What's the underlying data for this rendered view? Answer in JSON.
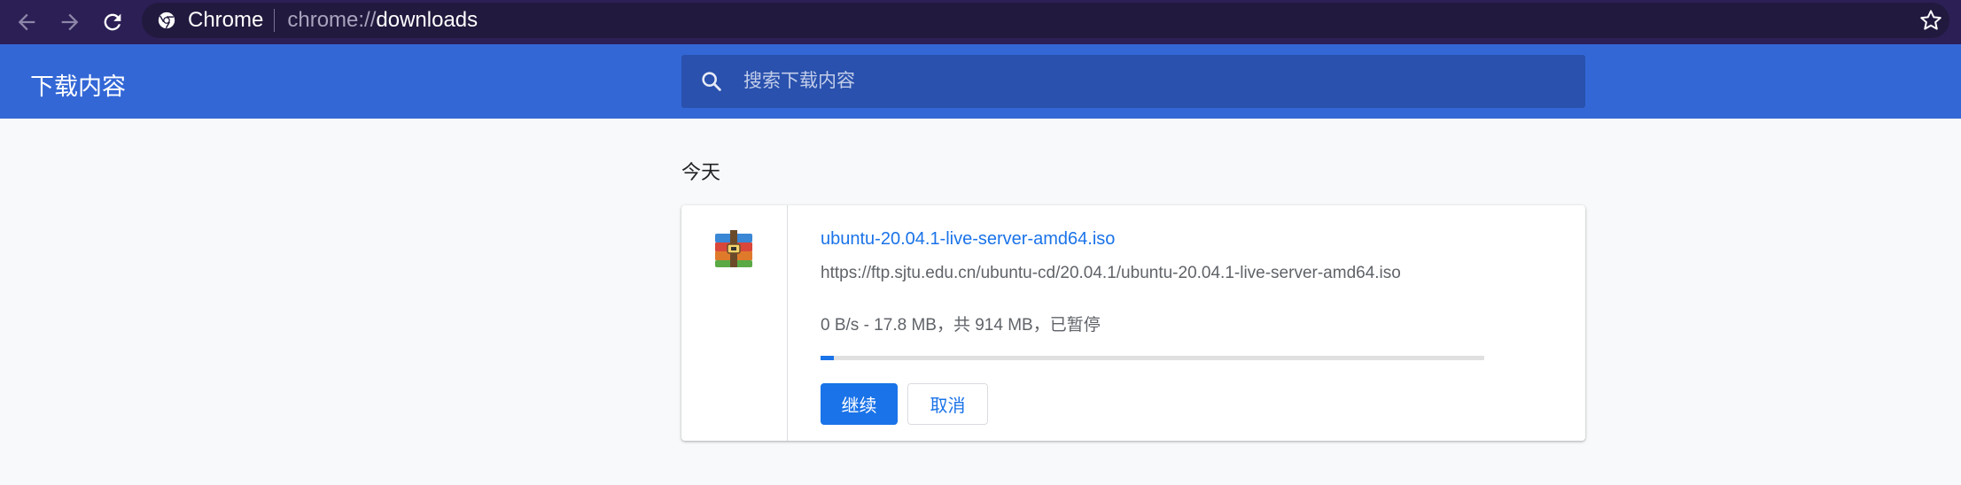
{
  "browser": {
    "site_name": "Chrome",
    "url_scheme": "chrome://",
    "url_host": "downloads",
    "icons": {
      "back": "back-arrow-icon",
      "forward": "forward-arrow-icon",
      "reload": "reload-icon",
      "site": "chrome-logo-icon",
      "bookmark": "star-icon"
    }
  },
  "header": {
    "title": "下载内容",
    "search_placeholder": "搜索下载内容",
    "search_value": ""
  },
  "section_date": "今天",
  "download": {
    "file_name": "ubuntu-20.04.1-live-server-amd64.iso",
    "url": "https://ftp.sjtu.edu.cn/ubuntu-cd/20.04.1/ubuntu-20.04.1-live-server-amd64.iso",
    "status": "0 B/s - 17.8 MB，共 914 MB，已暂停",
    "progress_fraction": 0.0195,
    "resume_label": "继续",
    "cancel_label": "取消",
    "icon": "winrar-archive-icon"
  },
  "colors": {
    "browser_bar": "#2b1f55",
    "header_bg": "#3367d6",
    "accent": "#1a73e8"
  }
}
